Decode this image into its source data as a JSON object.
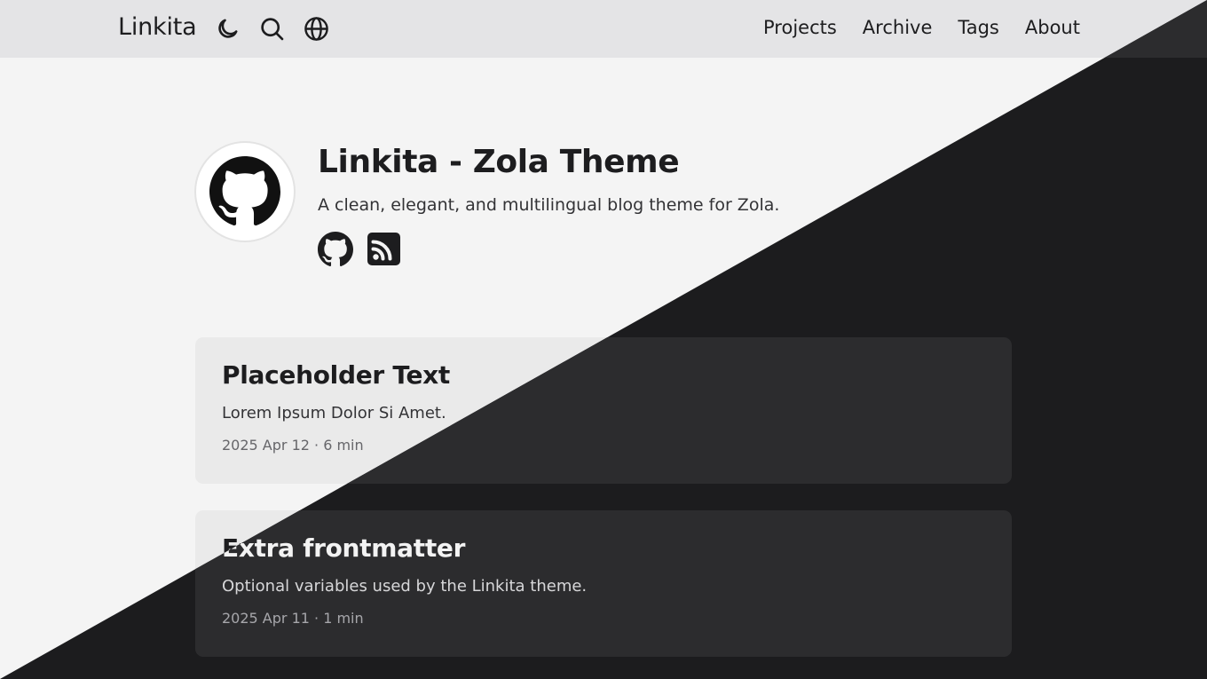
{
  "header": {
    "brand": "Linkita",
    "icons": [
      "moon-icon",
      "search-icon",
      "globe-icon"
    ],
    "nav_items": [
      {
        "label": "Projects"
      },
      {
        "label": "Archive"
      },
      {
        "label": "Tags"
      },
      {
        "label": "About"
      }
    ]
  },
  "profile": {
    "title": "Linkita - Zola Theme",
    "subtitle": "A clean, elegant, and multilingual blog theme for Zola.",
    "avatar_icon": "github-icon",
    "social_icons": [
      "github-icon",
      "rss-icon"
    ]
  },
  "posts": [
    {
      "title": "Placeholder Text",
      "summary": "Lorem Ipsum Dolor Si Amet.",
      "meta": "2025 Apr 12 · 6 min"
    },
    {
      "title": "Extra frontmatter",
      "summary": "Optional variables used by the Linkita theme.",
      "meta": "2025 Apr 11 · 1 min"
    }
  ],
  "colors": {
    "light_background": "#f4f4f4",
    "light_header": "#e4e4e6",
    "light_card": "#eaeaea",
    "dark_background": "#1c1c1e",
    "dark_header": "#2c2c2e",
    "dark_card": "#2c2c2e"
  }
}
